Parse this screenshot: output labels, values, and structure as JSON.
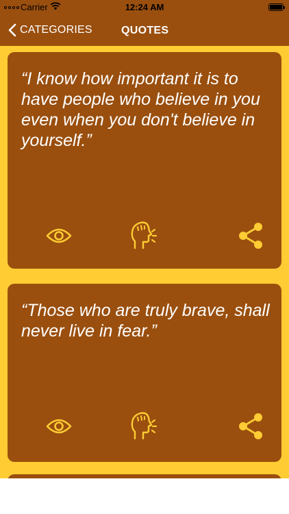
{
  "colors": {
    "background": "#ffcc33",
    "bar": "#9a4f0e",
    "card": "#9a4f0e",
    "icon": "#ffcc33",
    "text": "#ffffff"
  },
  "status_bar": {
    "carrier": "Carrier",
    "time": "12:24 AM",
    "icons": [
      "signal-dots-icon",
      "wifi-icon",
      "battery-icon"
    ]
  },
  "nav": {
    "back_label": "CATEGORIES",
    "back_icon": "chevron-left-icon",
    "title": "QUOTES"
  },
  "quotes": [
    {
      "text": "“I know how important it is to have people who believe in you even when you don't believe in yourself.”",
      "actions": [
        "eye-icon",
        "speaking-head-icon",
        "share-icon"
      ]
    },
    {
      "text": "“Those who are truly brave, shall never live in fear.”",
      "actions": [
        "eye-icon",
        "speaking-head-icon",
        "share-icon"
      ]
    }
  ]
}
